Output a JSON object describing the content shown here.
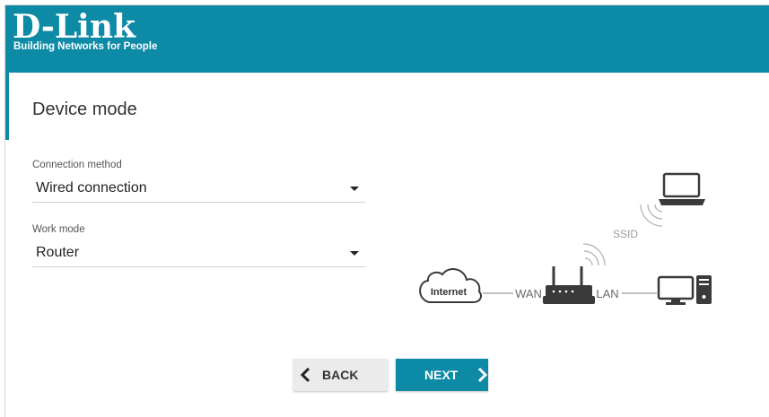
{
  "brand": {
    "logo": "D-Link",
    "tagline": "Building Networks for People",
    "header_color": "#0d8aa6"
  },
  "page": {
    "title": "Device mode"
  },
  "form": {
    "connection_method": {
      "label": "Connection method",
      "value": "Wired connection"
    },
    "work_mode": {
      "label": "Work mode",
      "value": "Router"
    }
  },
  "diagram": {
    "internet_label": "Internet",
    "wan_label": "WAN",
    "lan_label": "LAN",
    "ssid_label": "SSID",
    "icons": [
      "cloud-icon",
      "router-icon",
      "desktop-computer-icon",
      "laptop-icon",
      "wifi-signal-icon"
    ]
  },
  "buttons": {
    "back_label": "BACK",
    "next_label": "NEXT",
    "back_icon": "chevron-left-icon",
    "next_icon": "chevron-right-icon"
  }
}
